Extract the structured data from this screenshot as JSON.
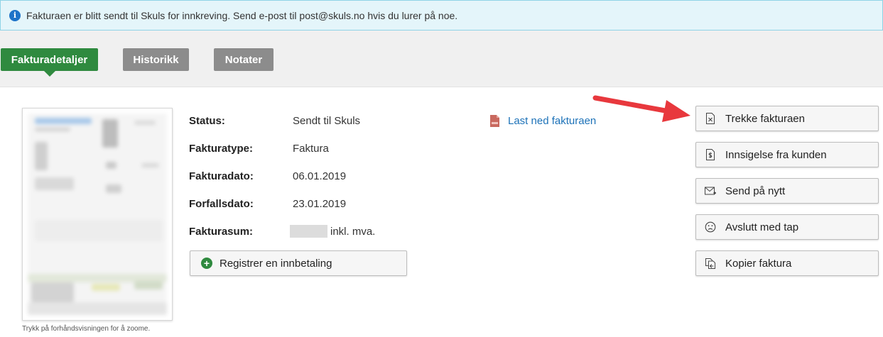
{
  "notice": {
    "text": "Fakturaen er blitt sendt til Skuls for innkreving. Send e-post til post@skuls.no hvis du lurer på noe.",
    "color": "#e4f5fa"
  },
  "tabs": [
    {
      "label": "Fakturadetaljer",
      "active": true
    },
    {
      "label": "Historikk",
      "active": false
    },
    {
      "label": "Notater",
      "active": false
    }
  ],
  "preview": {
    "caption": "Trykk på forhåndsvisningen for å zoome."
  },
  "details": {
    "status_label": "Status:",
    "status_value": "Sendt til Skuls",
    "type_label": "Fakturatype:",
    "type_value": "Faktura",
    "date_label": "Fakturadato:",
    "date_value": "06.01.2019",
    "due_label": "Forfallsdato:",
    "due_value": "23.01.2019",
    "sum_label": "Fakturasum:",
    "sum_suffix": "inkl. mva."
  },
  "register_payment_label": "Registrer en innbetaling",
  "download_label": "Last ned fakturaen",
  "actions": {
    "withdraw": "Trekke fakturaen",
    "objection": "Innsigelse fra kunden",
    "resend": "Send på nytt",
    "close_loss": "Avslutt med tap",
    "copy": "Kopier faktura"
  },
  "colors": {
    "accent_green": "#2f8a3f",
    "tab_inactive": "#8c8c8c",
    "link_blue": "#1d72b8",
    "annotation_arrow": "#e8383d"
  }
}
